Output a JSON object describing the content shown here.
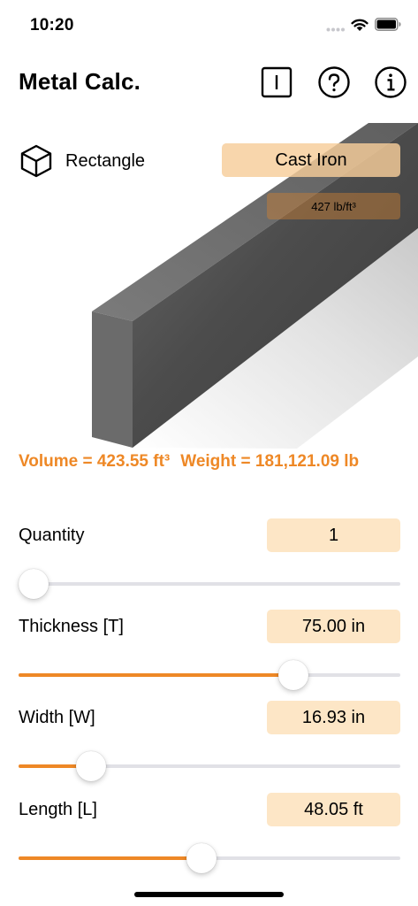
{
  "status": {
    "time": "10:20"
  },
  "header": {
    "title": "Metal Calc.",
    "icons": [
      "text-cursor-icon",
      "help-icon",
      "info-icon"
    ]
  },
  "shape": {
    "label": "Rectangle",
    "icon": "cube-icon"
  },
  "material": {
    "name": "Cast Iron",
    "density": "427 lb/ft³"
  },
  "result": {
    "volume": "Volume = 423.55 ft³",
    "weight": "Weight = 181,121.09 lb"
  },
  "params": [
    {
      "label": "Quantity",
      "value": "1",
      "slider_fraction": 0.04
    },
    {
      "label": "Thickness [T]",
      "value": "75.00 in",
      "slider_fraction": 0.72
    },
    {
      "label": "Width [W]",
      "value": "16.93 in",
      "slider_fraction": 0.19
    },
    {
      "label": "Length [L]",
      "value": "48.05 ft",
      "slider_fraction": 0.48
    }
  ],
  "colors": {
    "accent": "#ee8826",
    "value_field": "#fde6c6",
    "material_button": "#f6cd9a",
    "bar_front": "#6b6b6b",
    "bar_top": "#7a7a7a"
  }
}
